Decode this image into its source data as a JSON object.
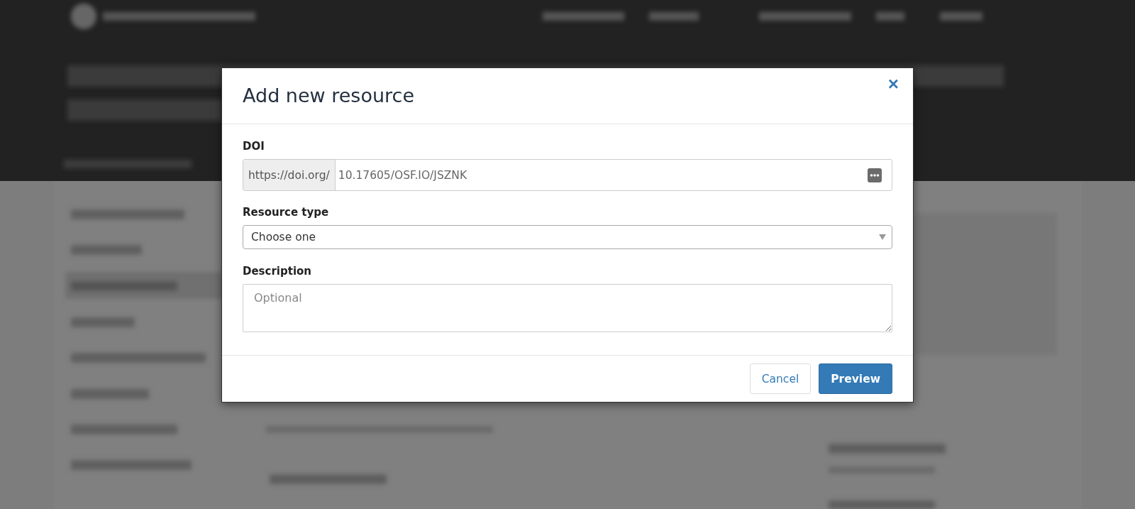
{
  "dialog": {
    "title": "Add new resource",
    "close": "×",
    "doi": {
      "label": "DOI",
      "prefix": "https://doi.org/",
      "value": "10.17605/OSF.IO/JSZNK"
    },
    "resource_type": {
      "label": "Resource type",
      "value": "Choose one"
    },
    "description": {
      "label": "Description",
      "placeholder": "Optional"
    },
    "buttons": [
      {
        "label": "Cancel",
        "kind": "secondary"
      },
      {
        "label": "Preview",
        "kind": "primary"
      }
    ]
  }
}
